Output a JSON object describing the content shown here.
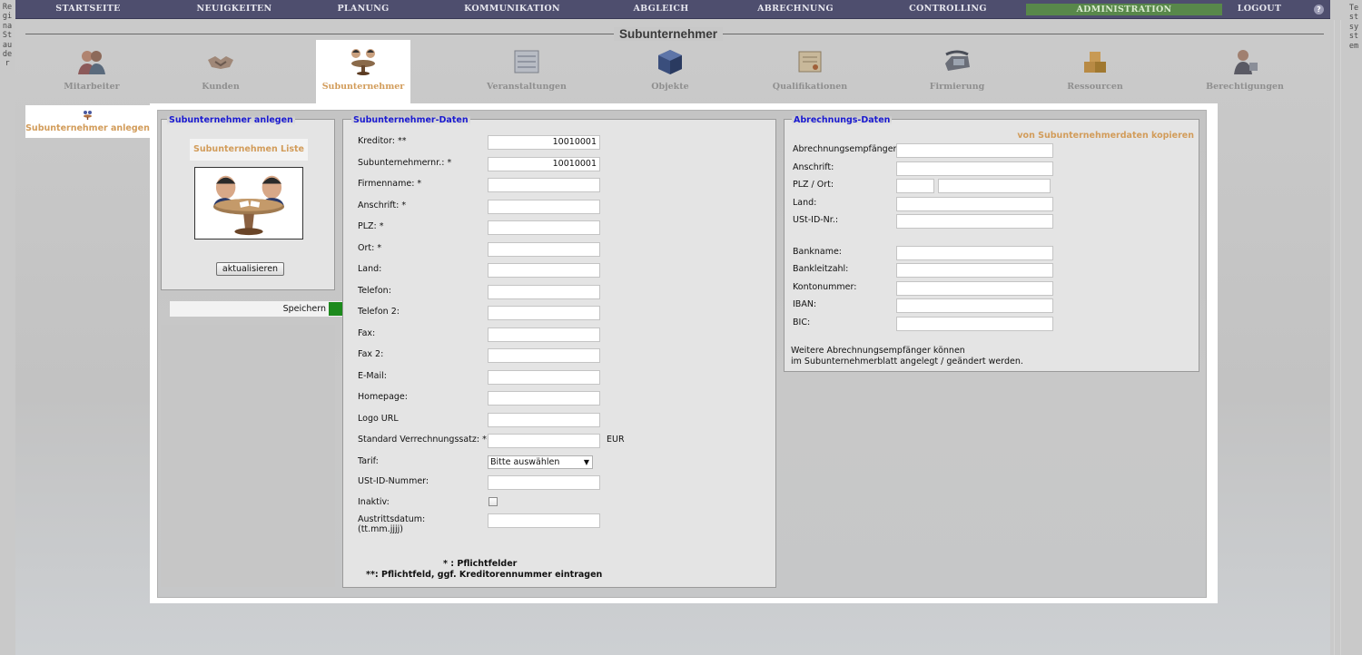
{
  "user_name": "Regina Stauder",
  "system_name": "Testsystem",
  "nav": [
    {
      "label": "STARTSEITE",
      "active": false
    },
    {
      "label": "NEUIGKEITEN",
      "active": false
    },
    {
      "label": "PLANUNG",
      "active": false
    },
    {
      "label": "KOMMUNIKATION",
      "active": false
    },
    {
      "label": "ABGLEICH",
      "active": false
    },
    {
      "label": "ABRECHNUNG",
      "active": false
    },
    {
      "label": "CONTROLLING",
      "active": false
    },
    {
      "label": "ADMINISTRATION",
      "active": true
    },
    {
      "label": "LOGOUT",
      "active": false
    }
  ],
  "page_title": "Subunternehmer",
  "categories": [
    {
      "label": "Mitarbeiter",
      "icon": "people-icon",
      "active": false
    },
    {
      "label": "Kunden",
      "icon": "handshake-icon",
      "active": false
    },
    {
      "label": "Subunternehmer",
      "icon": "meeting-table-icon",
      "active": true
    },
    {
      "label": "Veranstaltungen",
      "icon": "schedule-board-icon",
      "active": false
    },
    {
      "label": "Objekte",
      "icon": "cube-icon",
      "active": false
    },
    {
      "label": "Qualifikationen",
      "icon": "certificate-icon",
      "active": false
    },
    {
      "label": "Firmierung",
      "icon": "telephone-icon",
      "active": false
    },
    {
      "label": "Ressourcen",
      "icon": "boxes-icon",
      "active": false
    },
    {
      "label": "Berechtigungen",
      "icon": "person-lock-icon",
      "active": false
    }
  ],
  "side_tab": {
    "label": "Subunternehmer anlegen"
  },
  "left_box": {
    "legend": "Subunternehmer anlegen",
    "list_link": "Subunternehmen Liste",
    "refresh_button": "aktualisieren",
    "save_label": "Speichern"
  },
  "sub_data": {
    "legend": "Subunternehmer-Daten",
    "fields": [
      {
        "label": "Kreditor: **",
        "value": "10010001"
      },
      {
        "label": "Subunternehmernr.: *",
        "value": "10010001"
      },
      {
        "label": "Firmenname: *",
        "value": ""
      },
      {
        "label": "Anschrift: *",
        "value": ""
      },
      {
        "label": "PLZ: *",
        "value": ""
      },
      {
        "label": "Ort: *",
        "value": ""
      },
      {
        "label": "Land:",
        "value": ""
      },
      {
        "label": "Telefon:",
        "value": ""
      },
      {
        "label": "Telefon 2:",
        "value": ""
      },
      {
        "label": "Fax:",
        "value": ""
      },
      {
        "label": "Fax 2:",
        "value": ""
      },
      {
        "label": "E-Mail:",
        "value": ""
      },
      {
        "label": "Homepage:",
        "value": ""
      },
      {
        "label": "Logo URL",
        "value": ""
      },
      {
        "label": "Standard Verrechnungssatz: *",
        "value": ""
      }
    ],
    "currency": "EUR",
    "tarif_label": "Tarif:",
    "tarif_selected": "Bitte auswählen",
    "ust_label": "USt-ID-Nummer:",
    "ust_value": "",
    "inaktiv_label": "Inaktiv:",
    "inaktiv_checked": false,
    "austritt_label_1": "Austrittsdatum:",
    "austritt_label_2": "(tt.mm.jjjj)",
    "austritt_value": "",
    "note_1": "* : Pflichtfelder",
    "note_2": "**: Pflichtfeld, ggf. Kreditorennummer eintragen"
  },
  "billing": {
    "legend": "Abrechnungs-Daten",
    "copy_link": "von Subunternehmerdaten kopieren",
    "fields_top": [
      {
        "label": "Abrechnungsempfänger:",
        "value": ""
      },
      {
        "label": "Anschrift:",
        "value": ""
      },
      {
        "label": "PLZ / Ort:",
        "value": ""
      },
      {
        "label": "Land:",
        "value": ""
      },
      {
        "label": "USt-ID-Nr.:",
        "value": ""
      }
    ],
    "fields_bank": [
      {
        "label": "Bankname:",
        "value": ""
      },
      {
        "label": "Bankleitzahl:",
        "value": ""
      },
      {
        "label": "Kontonummer:",
        "value": ""
      },
      {
        "label": "IBAN:",
        "value": ""
      },
      {
        "label": "BIC:",
        "value": ""
      }
    ],
    "info_1": "Weitere Abrechnungsempfänger können",
    "info_2": "im Subunternehmerblatt angelegt / geändert werden."
  },
  "colors": {
    "nav_bg": "#4e4e6e",
    "nav_active": "#58884a",
    "accent_orange": "#d29c5a",
    "legend_blue": "#1a1ad0",
    "save_green": "#1c8a1c"
  }
}
